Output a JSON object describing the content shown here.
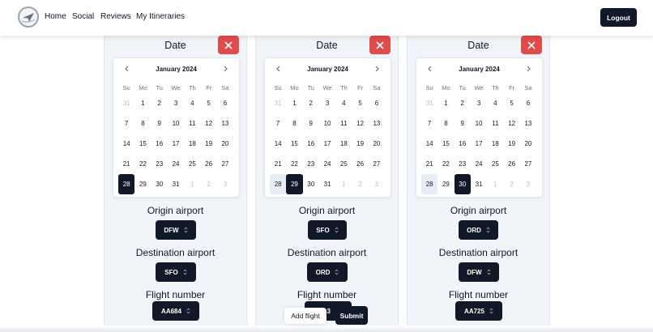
{
  "nav": {
    "links": [
      "Home",
      "Social",
      "Reviews",
      "My Itineraries"
    ],
    "logout_label": "Logout"
  },
  "common": {
    "date_title": "Date",
    "month_label": "January 2024",
    "weekdays": [
      "Su",
      "Mo",
      "Tu",
      "We",
      "Th",
      "Fr",
      "Sa"
    ],
    "origin_label": "Origin airport",
    "destination_label": "Destination airport",
    "flight_label": "Flight number"
  },
  "calendar_days": [
    [
      {
        "d": "31",
        "m": true
      },
      {
        "d": "1"
      },
      {
        "d": "2"
      },
      {
        "d": "3"
      },
      {
        "d": "4"
      },
      {
        "d": "5"
      },
      {
        "d": "6"
      }
    ],
    [
      {
        "d": "7"
      },
      {
        "d": "8"
      },
      {
        "d": "9"
      },
      {
        "d": "10"
      },
      {
        "d": "11"
      },
      {
        "d": "12"
      },
      {
        "d": "13"
      }
    ],
    [
      {
        "d": "14"
      },
      {
        "d": "15"
      },
      {
        "d": "16"
      },
      {
        "d": "17"
      },
      {
        "d": "18"
      },
      {
        "d": "19"
      },
      {
        "d": "20"
      }
    ],
    [
      {
        "d": "21"
      },
      {
        "d": "22"
      },
      {
        "d": "23"
      },
      {
        "d": "24"
      },
      {
        "d": "25"
      },
      {
        "d": "26"
      },
      {
        "d": "27"
      }
    ],
    [
      {
        "d": "28"
      },
      {
        "d": "29"
      },
      {
        "d": "30"
      },
      {
        "d": "31"
      },
      {
        "d": "1",
        "m": true
      },
      {
        "d": "2",
        "m": true
      },
      {
        "d": "3",
        "m": true
      }
    ]
  ],
  "panels": [
    {
      "selected_day": "28",
      "today_day": "28",
      "origin": "DFW",
      "destination": "SFO",
      "flight": "AA684"
    },
    {
      "selected_day": "29",
      "today_day": "28",
      "origin": "SFO",
      "destination": "ORD",
      "flight": "3"
    },
    {
      "selected_day": "30",
      "today_day": "28",
      "origin": "ORD",
      "destination": "DFW",
      "flight": "AA725"
    }
  ],
  "footer": {
    "add_flight_label": "Add flight",
    "submit_label": "Submit"
  },
  "colors": {
    "dark": "#111827",
    "danger": "#e24b4b",
    "panel_bg": "#f1f5f9"
  },
  "icons": {
    "close": "close-icon",
    "prev": "chevron-left-icon",
    "next": "chevron-right-icon",
    "select": "chevron-up-down-icon"
  }
}
